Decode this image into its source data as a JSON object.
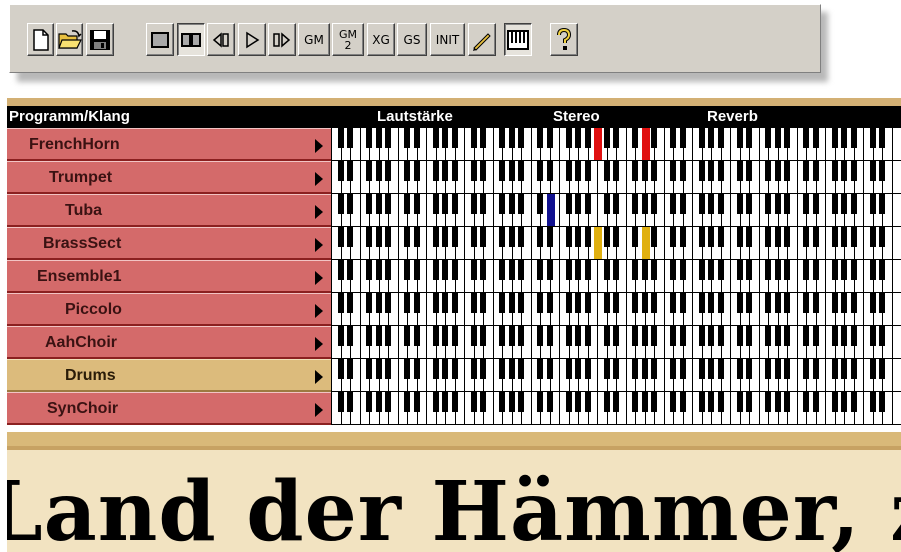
{
  "toolbar": {
    "buttons": [
      {
        "name": "new-file-button",
        "icon": "new-file-icon",
        "label": "",
        "pressed": false
      },
      {
        "name": "open-file-button",
        "icon": "open-folder-icon",
        "label": "",
        "pressed": false
      },
      {
        "name": "save-file-button",
        "icon": "save-disk-icon",
        "label": "",
        "pressed": false
      },
      {
        "name": "single-view-button",
        "icon": "single-square-icon",
        "label": "",
        "pressed": false
      },
      {
        "name": "double-view-button",
        "icon": "double-square-icon",
        "label": "",
        "pressed": true
      },
      {
        "name": "rewind-button",
        "icon": "rewind-icon",
        "label": "",
        "pressed": false
      },
      {
        "name": "play-button",
        "icon": "play-icon",
        "label": "",
        "pressed": false
      },
      {
        "name": "forward-button",
        "icon": "forward-icon",
        "label": "",
        "pressed": false
      },
      {
        "name": "gm-button",
        "icon": "",
        "label": "GM",
        "pressed": false
      },
      {
        "name": "gm2-button",
        "icon": "",
        "label": "GM\n2",
        "pressed": false
      },
      {
        "name": "xg-button",
        "icon": "",
        "label": "XG",
        "pressed": false
      },
      {
        "name": "gs-button",
        "icon": "",
        "label": "GS",
        "pressed": false
      },
      {
        "name": "init-button",
        "icon": "",
        "label": "INIT",
        "pressed": false
      },
      {
        "name": "pencil-button",
        "icon": "pencil-icon",
        "label": "",
        "pressed": false
      },
      {
        "name": "piano-button",
        "icon": "piano-keyboard-icon",
        "label": "",
        "pressed": true
      },
      {
        "name": "help-button",
        "icon": "question-mark-icon",
        "label": "",
        "pressed": false
      }
    ]
  },
  "header": {
    "program_label": "Programm/Klang",
    "volume_label": "Lautstärke",
    "stereo_label": "Stereo",
    "reverb_label": "Reverb"
  },
  "rows": [
    {
      "name": "FrenchHorn",
      "color": "red",
      "markers": [
        {
          "key": 28,
          "color": "#e01010"
        },
        {
          "key": 33,
          "color": "#e01010"
        }
      ]
    },
    {
      "name": "Trumpet",
      "color": "red",
      "markers": []
    },
    {
      "name": "Tuba",
      "color": "red",
      "markers": [
        {
          "key": 23,
          "color": "#101090"
        }
      ]
    },
    {
      "name": "BrassSect",
      "color": "red",
      "markers": [
        {
          "key": 28,
          "color": "#e0b010"
        },
        {
          "key": 33,
          "color": "#e0b010"
        }
      ]
    },
    {
      "name": "Ensemble1",
      "color": "red",
      "markers": []
    },
    {
      "name": "Piccolo",
      "color": "red",
      "markers": []
    },
    {
      "name": "AahChoir",
      "color": "red",
      "markers": []
    },
    {
      "name": "Drums",
      "color": "gold",
      "markers": []
    },
    {
      "name": "SynChoir",
      "color": "red",
      "markers": []
    }
  ],
  "bottom_text": "Land der Hämmer, zu"
}
